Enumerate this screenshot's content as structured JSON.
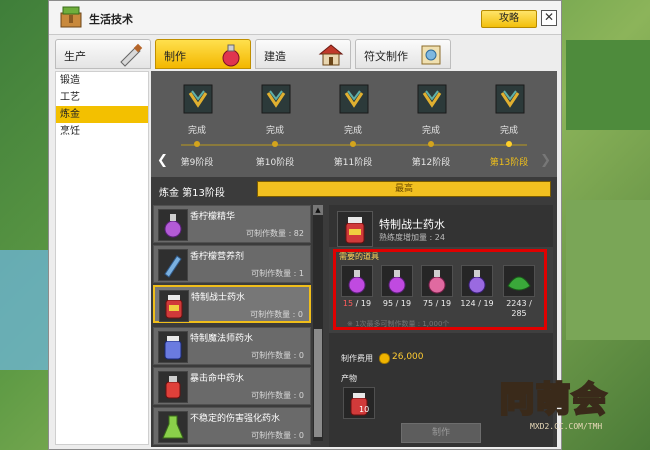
{
  "window": {
    "title": "生活技术",
    "guide_button": "攻略",
    "close": "✕"
  },
  "tabs": [
    {
      "label": "生产",
      "icon": "saw-icon",
      "active": false
    },
    {
      "label": "制作",
      "icon": "potion-icon",
      "active": true
    },
    {
      "label": "建造",
      "icon": "house-icon",
      "active": false
    },
    {
      "label": "符文制作",
      "icon": "scroll-icon",
      "active": false
    }
  ],
  "sidebar": {
    "items": [
      {
        "label": "锻造",
        "active": false
      },
      {
        "label": "工艺",
        "active": false
      },
      {
        "label": "炼金",
        "active": true
      },
      {
        "label": "烹饪",
        "active": false
      }
    ]
  },
  "stages": [
    {
      "done": "完成",
      "name": "第9阶段",
      "current": false
    },
    {
      "done": "完成",
      "name": "第10阶段",
      "current": false
    },
    {
      "done": "完成",
      "name": "第11阶段",
      "current": false
    },
    {
      "done": "完成",
      "name": "第12阶段",
      "current": false
    },
    {
      "done": "完成",
      "name": "第13阶段",
      "current": true
    }
  ],
  "level": {
    "label": "炼金 第13阶段",
    "bar_text": "最高",
    "progress": 1.0
  },
  "recipes": [
    {
      "name": "香柠檬精华",
      "qty": "可制作数量 : 82",
      "color": "#b35bd6"
    },
    {
      "name": "香柠檬营养剂",
      "qty": "可制作数量 : 1",
      "color": "#7ab0e0"
    },
    {
      "name": "特制战士药水",
      "qty": "可制作数量 : 0",
      "color": "#d13a3a",
      "selected": true
    },
    {
      "name": "特制魔法师药水",
      "qty": "可制作数量 : 0",
      "color": "#6a7be0"
    },
    {
      "name": "暴击命中药水",
      "qty": "可制作数量 : 0",
      "color": "#e0403a"
    },
    {
      "name": "不稳定的伤害强化药水",
      "qty": "可制作数量 : 0",
      "color": "#8ad04a"
    }
  ],
  "detail": {
    "name": "特制战士药水",
    "sub": "熟练度增加量 : 24",
    "materials_title": "需要的道具",
    "materials": [
      {
        "have": "15",
        "need": "19",
        "short": true,
        "color": "#c04ae0"
      },
      {
        "have": "95",
        "need": "19",
        "short": false,
        "color": "#c04ae0"
      },
      {
        "have": "75",
        "need": "19",
        "short": false,
        "color": "#e06aa0"
      },
      {
        "have": "124",
        "need": "19",
        "short": false,
        "color": "#9a6ae0"
      },
      {
        "have": "2243",
        "need": "285",
        "short": false,
        "color": "#3aa83a"
      }
    ],
    "note": "※ 1次最多可制作数量 : 1,000个",
    "cost_label": "制作费用",
    "cost_value": "26,000",
    "product_label": "产物",
    "product_qty": "10",
    "make_button": "制作"
  },
  "watermark": {
    "text": "同萌会",
    "url": "MXD2.CC.COM/TMH"
  }
}
